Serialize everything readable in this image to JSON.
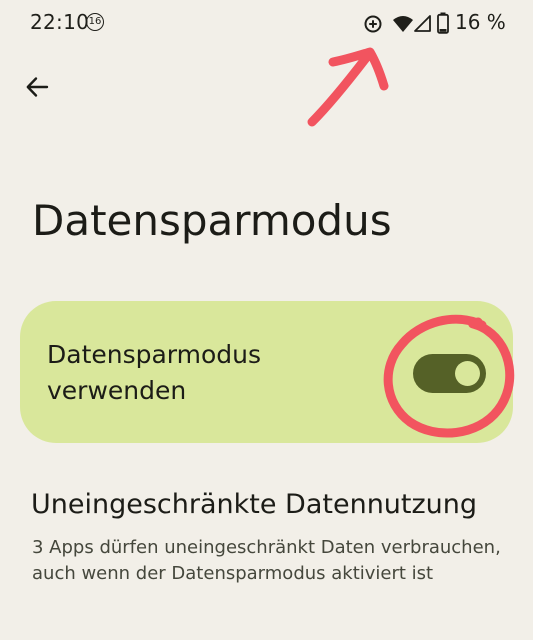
{
  "status_bar": {
    "time": "22:10",
    "notification_badge": "16",
    "battery_percent": "16 %",
    "icons": [
      "data-saver-icon",
      "wifi-icon",
      "cellular-signal-icon",
      "battery-icon"
    ]
  },
  "header": {
    "back_icon": "arrow-left-icon",
    "title": "Datensparmodus"
  },
  "toggle_card": {
    "label": "Datensparmodus verwenden",
    "enabled": true,
    "colors": {
      "card": "#d9e79b",
      "track": "#556127",
      "thumb": "#d9e79b"
    }
  },
  "unrestricted": {
    "title": "Uneingeschränkte Datennutzung",
    "summary": "3 Apps dürfen uneingeschränkt Daten verbrauchen, auch wenn der Datensparmodus aktiviert ist"
  },
  "annotation_color": "#f2545f"
}
